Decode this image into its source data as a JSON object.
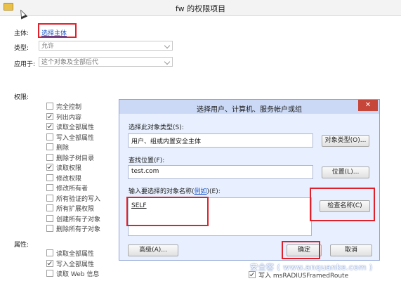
{
  "window": {
    "title": "fw 的权限项目"
  },
  "principal": {
    "label": "主体:",
    "link": "选择主体"
  },
  "type": {
    "label": "类型:",
    "value": "允许"
  },
  "applies_to": {
    "label": "应用于:",
    "value": "这个对象及全部后代"
  },
  "permissions": {
    "label": "权限:",
    "items": [
      {
        "label": "完全控制",
        "checked": false
      },
      {
        "label": "列出内容",
        "checked": true
      },
      {
        "label": "读取全部属性",
        "checked": true
      },
      {
        "label": "写入全部属性",
        "checked": false
      },
      {
        "label": "删除",
        "checked": false
      },
      {
        "label": "删除子树目录",
        "checked": false
      },
      {
        "label": "读取权限",
        "checked": true
      },
      {
        "label": "修改权限",
        "checked": false
      },
      {
        "label": "修改所有者",
        "checked": false
      },
      {
        "label": "所有验证的写入",
        "checked": false
      },
      {
        "label": "所有扩展权限",
        "checked": false
      },
      {
        "label": "创建所有子对象",
        "checked": false
      },
      {
        "label": "删除所有子对象",
        "checked": false
      }
    ]
  },
  "properties": {
    "label": "属性:",
    "items": [
      {
        "label": "读取全部属性",
        "checked": false
      },
      {
        "label": "写入全部属性",
        "checked": true
      },
      {
        "label": "读取 Web 信息",
        "checked": false
      }
    ],
    "right_item": {
      "label": "写入 msRADIUSFramedRoute",
      "checked": true
    }
  },
  "dialog": {
    "title": "选择用户、计算机、服务帐户或组",
    "close": "✕",
    "object_type_label": "选择此对象类型(S):",
    "object_type_value": "用户、组或内置安全主体",
    "object_type_button": "对象类型(O)...",
    "location_label": "查找位置(F):",
    "location_value": "test.com",
    "location_button": "位置(L)...",
    "names_label_prefix": "输入要选择的对象名称(",
    "names_label_link": "例如",
    "names_label_suffix": ")(E):",
    "names_value": "SELF",
    "check_names_button": "检查名称(C)",
    "advanced_button": "高级(A)...",
    "ok_button": "确定",
    "cancel_button": "取消"
  },
  "watermark": "安全客 ( www.anquanke.com )"
}
